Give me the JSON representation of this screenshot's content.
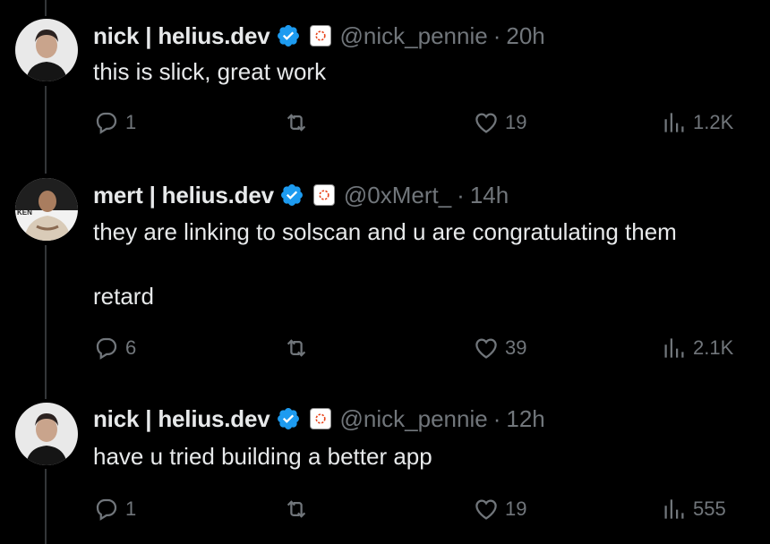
{
  "tweets": [
    {
      "name": "nick | helius.dev",
      "handle": "@nick_pennie",
      "separator": "·",
      "time": "20h",
      "text": "this is slick, great work",
      "replies": "1",
      "retweets": "",
      "likes": "19",
      "views": "1.2K"
    },
    {
      "name": "mert | helius.dev",
      "handle": "@0xMert_",
      "separator": "·",
      "time": "14h",
      "text": "they are linking to solscan and u are congratulating them\n\nretard",
      "replies": "6",
      "retweets": "",
      "likes": "39",
      "views": "2.1K"
    },
    {
      "name": "nick | helius.dev",
      "handle": "@nick_pennie",
      "separator": "·",
      "time": "12h",
      "text": "have u tried building a better app",
      "replies": "1",
      "retweets": "",
      "likes": "19",
      "views": "555"
    }
  ],
  "colors": {
    "background": "#000000",
    "text": "#e7e9ea",
    "muted": "#71767b",
    "verified": "#1d9bf0",
    "affiliate_accent": "#e8431a"
  },
  "icons": [
    "reply-icon",
    "retweet-icon",
    "like-icon",
    "views-icon",
    "verified-badge-icon",
    "helius-affiliate-icon"
  ]
}
